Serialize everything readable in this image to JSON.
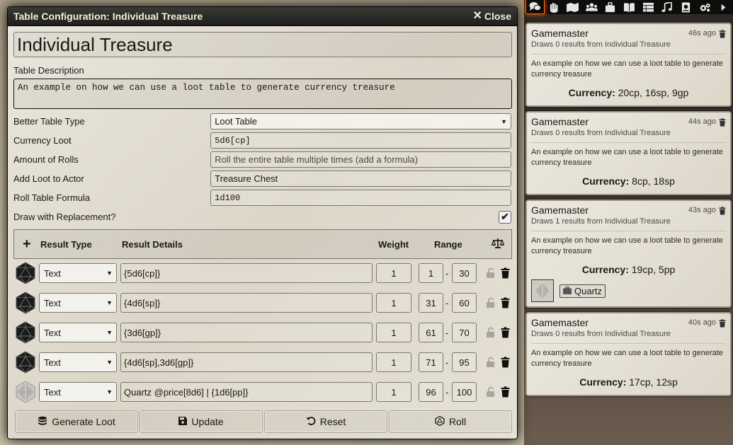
{
  "window": {
    "title": "Table Configuration: Individual Treasure",
    "close_label": "Close"
  },
  "table": {
    "name": "Individual Treasure",
    "description_label": "Table Description",
    "description": "An example on how we can use a loot table to generate currency treasure",
    "fields": [
      {
        "label": "Better Table Type",
        "value": "Loot Table",
        "kind": "select"
      },
      {
        "label": "Currency Loot",
        "value": "5d6[cp]",
        "kind": "mono"
      },
      {
        "label": "Amount of Rolls",
        "value": "Roll the entire table multiple times (add a formula)",
        "kind": "placeholder"
      },
      {
        "label": "Add Loot to Actor",
        "value": "Treasure Chest",
        "kind": "text"
      },
      {
        "label": "Roll Table Formula",
        "value": "1d100",
        "kind": "mono"
      }
    ],
    "replacement_label": "Draw with Replacement?",
    "replacement_checked": true
  },
  "results_header": {
    "add": "+",
    "result_type": "Result Type",
    "result_details": "Result Details",
    "weight": "Weight",
    "range": "Range"
  },
  "results": [
    {
      "icon": "d20-black-icon",
      "type": "Text",
      "details": "{5d6[cp]}",
      "weight": "1",
      "low": "1",
      "high": "30"
    },
    {
      "icon": "d20-black-icon",
      "type": "Text",
      "details": "{4d6[sp]}",
      "weight": "1",
      "low": "31",
      "high": "60"
    },
    {
      "icon": "d20-black-icon",
      "type": "Text",
      "details": "{3d6[gp]}",
      "weight": "1",
      "low": "61",
      "high": "70"
    },
    {
      "icon": "d20-black-icon",
      "type": "Text",
      "details": "{4d6[sp],3d6[gp]}",
      "weight": "1",
      "low": "71",
      "high": "95"
    },
    {
      "icon": "crystal-icon",
      "type": "Text",
      "details": "Quartz @price[8d6] | {1d6[pp]}",
      "weight": "1",
      "low": "96",
      "high": "100"
    }
  ],
  "footer": {
    "generate": "Generate Loot",
    "update": "Update",
    "reset": "Reset",
    "roll": "Roll"
  },
  "sidebar_tabs": [
    "chat-icon",
    "combat-icon",
    "scenes-icon",
    "actors-icon",
    "items-icon",
    "journal-icon",
    "tables-icon",
    "playlists-icon",
    "compendium-icon",
    "settings-icon",
    "collapse-icon"
  ],
  "chat": [
    {
      "sender": "Gamemaster",
      "time": "46s ago",
      "flavor": "Draws 0 results from Individual Treasure",
      "desc": "An example on how we can use a loot table to generate currency treasure",
      "currency_label": "Currency:",
      "currency": "20cp, 16sp, 9gp"
    },
    {
      "sender": "Gamemaster",
      "time": "44s ago",
      "flavor": "Draws 0 results from Individual Treasure",
      "desc": "An example on how we can use a loot table to generate currency treasure",
      "currency_label": "Currency:",
      "currency": "8cp, 18sp"
    },
    {
      "sender": "Gamemaster",
      "time": "43s ago",
      "flavor": "Draws 1 results from Individual Treasure",
      "desc": "An example on how we can use a loot table to generate currency treasure",
      "currency_label": "Currency:",
      "currency": "19cp, 5pp",
      "item": "Quartz"
    },
    {
      "sender": "Gamemaster",
      "time": "40s ago",
      "flavor": "Draws 0 results from Individual Treasure",
      "desc": "An example on how we can use a loot table to generate currency treasure",
      "currency_label": "Currency:",
      "currency": "17cp, 12sp"
    }
  ]
}
